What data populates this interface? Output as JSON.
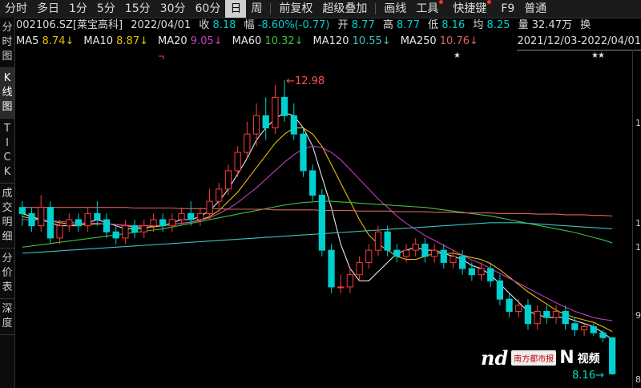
{
  "toolbar": {
    "items": [
      "分时",
      "多日",
      "1分",
      "5分",
      "15分",
      "30分",
      "60分",
      "日",
      "周",
      "前复权",
      "超级叠加",
      "画线",
      "工具",
      "快捷键",
      "F9",
      "普通"
    ],
    "active_index": 7
  },
  "sidebar": {
    "tabs": [
      {
        "label": "分时图",
        "chars": [
          "分",
          "时",
          "图"
        ]
      },
      {
        "label": "K线图",
        "chars": [
          "K",
          "线",
          "图"
        ]
      },
      {
        "label": "TICK",
        "chars": [
          "T",
          "I",
          "C",
          "K"
        ]
      },
      {
        "label": "成交明细",
        "chars": [
          "成",
          "交",
          "明",
          "细"
        ]
      },
      {
        "label": "分价表",
        "chars": [
          "分",
          "价",
          "表"
        ]
      },
      {
        "label": "深度",
        "chars": [
          "深",
          "度"
        ]
      }
    ],
    "active_index": 1
  },
  "info": {
    "symbol": "002106.SZ[莱宝高科]",
    "date": "2022/04/01",
    "close_label": "收",
    "close": "8.18",
    "change_label": "幅",
    "change": "-8.60%(-0.77)",
    "open_label": "开",
    "open": "8.77",
    "high_label": "高",
    "high": "8.77",
    "low_label": "低",
    "low": "8.16",
    "avg_label": "均",
    "avg": "8.25",
    "volume_label": "量",
    "volume": "32.47万",
    "amount_label": "换"
  },
  "ma": [
    {
      "label": "MA5",
      "value": "8.74↓",
      "color": "#e8e8e8",
      "value_color": "#e8c000"
    },
    {
      "label": "MA10",
      "value": "8.87↓",
      "color": "#e8e8e8",
      "value_color": "#e8c000"
    },
    {
      "label": "MA20",
      "value": "9.05↓",
      "color": "#e8e8e8",
      "value_color": "#c040c0"
    },
    {
      "label": "MA60",
      "value": "10.32↓",
      "color": "#e8e8e8",
      "value_color": "#40c040"
    },
    {
      "label": "MA120",
      "value": "10.55↓",
      "color": "#e8e8e8",
      "value_color": "#40c0c0"
    },
    {
      "label": "MA250",
      "value": "10.76↓",
      "color": "#e8e8e8",
      "value_color": "#e06060"
    }
  ],
  "range": "2021/12/03-2022/04/01",
  "axis_ticks": [
    "1",
    "1",
    "1",
    "9",
    "8"
  ],
  "annotations": {
    "high_label": "12.98",
    "low_label": "8.16"
  },
  "watermark": {
    "nd": "nd",
    "box": "南方都市报",
    "n": "N",
    "video": "视频"
  },
  "colors": {
    "up": "#ff3b3b",
    "down": "#00d0d0",
    "ma5": "#e8e8e8",
    "ma10": "#e8c000",
    "ma20": "#c040c0",
    "ma60": "#40c040",
    "ma120": "#40c0c0",
    "ma250": "#e06060"
  },
  "chart_data": {
    "type": "candlestick",
    "ylim": [
      8.0,
      13.4
    ],
    "high_marker": 12.98,
    "low_marker": 8.16,
    "candles": [
      [
        10.9,
        11.0,
        10.6,
        10.8
      ],
      [
        10.8,
        10.9,
        10.5,
        10.6
      ],
      [
        10.6,
        11.1,
        10.5,
        10.9
      ],
      [
        10.9,
        11.0,
        10.3,
        10.4
      ],
      [
        10.4,
        10.7,
        10.3,
        10.6
      ],
      [
        10.6,
        10.8,
        10.5,
        10.7
      ],
      [
        10.7,
        10.8,
        10.5,
        10.6
      ],
      [
        10.6,
        10.9,
        10.5,
        10.8
      ],
      [
        10.8,
        11.0,
        10.6,
        10.7
      ],
      [
        10.7,
        10.8,
        10.4,
        10.5
      ],
      [
        10.5,
        10.6,
        10.3,
        10.4
      ],
      [
        10.4,
        10.7,
        10.3,
        10.6
      ],
      [
        10.6,
        10.7,
        10.4,
        10.5
      ],
      [
        10.5,
        10.7,
        10.4,
        10.6
      ],
      [
        10.6,
        10.8,
        10.5,
        10.7
      ],
      [
        10.7,
        10.8,
        10.5,
        10.6
      ],
      [
        10.6,
        10.8,
        10.5,
        10.7
      ],
      [
        10.7,
        10.9,
        10.6,
        10.8
      ],
      [
        10.8,
        11.0,
        10.6,
        10.7
      ],
      [
        10.7,
        10.9,
        10.6,
        10.8
      ],
      [
        10.8,
        11.2,
        10.7,
        11.0
      ],
      [
        11.0,
        11.3,
        10.9,
        11.2
      ],
      [
        11.2,
        11.6,
        11.1,
        11.5
      ],
      [
        11.5,
        11.9,
        11.4,
        11.8
      ],
      [
        11.8,
        12.3,
        11.7,
        12.1
      ],
      [
        12.1,
        12.6,
        11.9,
        12.4
      ],
      [
        12.4,
        12.7,
        12.0,
        12.2
      ],
      [
        12.2,
        12.9,
        12.1,
        12.7
      ],
      [
        12.7,
        12.98,
        12.3,
        12.4
      ],
      [
        12.4,
        12.6,
        12.0,
        12.1
      ],
      [
        12.1,
        12.2,
        11.4,
        11.5
      ],
      [
        11.5,
        11.6,
        11.0,
        11.1
      ],
      [
        11.1,
        11.2,
        10.1,
        10.2
      ],
      [
        10.2,
        10.3,
        9.5,
        9.6
      ],
      [
        9.6,
        9.8,
        9.5,
        9.6
      ],
      [
        9.6,
        9.9,
        9.5,
        9.8
      ],
      [
        9.8,
        10.1,
        9.7,
        10.0
      ],
      [
        10.0,
        10.3,
        9.9,
        10.2
      ],
      [
        10.2,
        10.6,
        10.1,
        10.5
      ],
      [
        10.5,
        10.6,
        10.1,
        10.2
      ],
      [
        10.2,
        10.3,
        10.0,
        10.1
      ],
      [
        10.1,
        10.3,
        10.0,
        10.2
      ],
      [
        10.2,
        10.4,
        10.1,
        10.3
      ],
      [
        10.3,
        10.4,
        10.0,
        10.1
      ],
      [
        10.1,
        10.3,
        10.0,
        10.2
      ],
      [
        10.2,
        10.3,
        9.9,
        10.0
      ],
      [
        10.0,
        10.2,
        9.9,
        10.1
      ],
      [
        10.1,
        10.2,
        9.8,
        9.9
      ],
      [
        9.9,
        10.0,
        9.7,
        9.8
      ],
      [
        9.8,
        10.0,
        9.7,
        9.9
      ],
      [
        9.9,
        10.0,
        9.6,
        9.7
      ],
      [
        9.7,
        9.8,
        9.3,
        9.4
      ],
      [
        9.4,
        9.5,
        9.1,
        9.2
      ],
      [
        9.2,
        9.4,
        9.1,
        9.3
      ],
      [
        9.3,
        9.4,
        8.9,
        9.0
      ],
      [
        9.0,
        9.3,
        8.9,
        9.2
      ],
      [
        9.2,
        9.3,
        9.0,
        9.1
      ],
      [
        9.1,
        9.3,
        9.0,
        9.2
      ],
      [
        9.2,
        9.3,
        8.9,
        9.0
      ],
      [
        9.0,
        9.1,
        8.8,
        8.9
      ],
      [
        8.9,
        9.0,
        8.8,
        8.95
      ],
      [
        8.95,
        9.0,
        8.8,
        8.85
      ],
      [
        8.85,
        8.9,
        8.7,
        8.77
      ],
      [
        8.77,
        8.77,
        8.16,
        8.18
      ]
    ],
    "ma_series": [
      {
        "name": "MA5",
        "values": [
          10.8,
          10.75,
          10.7,
          10.65,
          10.6,
          10.6,
          10.6,
          10.65,
          10.7,
          10.65,
          10.6,
          10.55,
          10.55,
          10.55,
          10.6,
          10.6,
          10.65,
          10.7,
          10.7,
          10.75,
          10.85,
          11.0,
          11.2,
          11.45,
          11.7,
          12.0,
          12.2,
          12.35,
          12.45,
          12.4,
          12.2,
          11.9,
          11.4,
          10.9,
          10.3,
          9.9,
          9.7,
          9.7,
          9.85,
          10.0,
          10.15,
          10.2,
          10.25,
          10.2,
          10.2,
          10.15,
          10.1,
          10.05,
          9.95,
          9.9,
          9.8,
          9.65,
          9.5,
          9.35,
          9.2,
          9.15,
          9.1,
          9.1,
          9.1,
          9.05,
          9.0,
          8.95,
          8.85,
          8.74
        ]
      },
      {
        "name": "MA10",
        "values": [
          10.75,
          10.72,
          10.7,
          10.68,
          10.65,
          10.63,
          10.62,
          10.62,
          10.63,
          10.63,
          10.62,
          10.6,
          10.58,
          10.58,
          10.58,
          10.6,
          10.62,
          10.64,
          10.66,
          10.7,
          10.75,
          10.85,
          11.0,
          11.15,
          11.35,
          11.55,
          11.75,
          11.95,
          12.1,
          12.2,
          12.2,
          12.1,
          11.9,
          11.6,
          11.3,
          11.0,
          10.7,
          10.45,
          10.3,
          10.2,
          10.1,
          10.05,
          10.05,
          10.1,
          10.15,
          10.15,
          10.15,
          10.12,
          10.08,
          10.05,
          9.98,
          9.88,
          9.76,
          9.64,
          9.52,
          9.42,
          9.32,
          9.22,
          9.15,
          9.1,
          9.06,
          9.02,
          8.95,
          8.87
        ]
      },
      {
        "name": "MA20",
        "values": [
          10.7,
          10.7,
          10.69,
          10.68,
          10.67,
          10.66,
          10.65,
          10.64,
          10.64,
          10.63,
          10.62,
          10.61,
          10.6,
          10.6,
          10.6,
          10.61,
          10.62,
          10.64,
          10.66,
          10.69,
          10.73,
          10.8,
          10.88,
          10.98,
          11.1,
          11.22,
          11.36,
          11.5,
          11.64,
          11.76,
          11.86,
          11.9,
          11.88,
          11.8,
          11.68,
          11.52,
          11.36,
          11.2,
          11.04,
          10.9,
          10.76,
          10.64,
          10.54,
          10.44,
          10.36,
          10.28,
          10.2,
          10.12,
          10.04,
          9.98,
          9.9,
          9.82,
          9.74,
          9.66,
          9.58,
          9.5,
          9.42,
          9.34,
          9.27,
          9.2,
          9.15,
          9.1,
          9.07,
          9.05
        ]
      },
      {
        "name": "MA60",
        "values": [
          10.25,
          10.27,
          10.29,
          10.31,
          10.33,
          10.35,
          10.37,
          10.39,
          10.41,
          10.43,
          10.45,
          10.47,
          10.49,
          10.51,
          10.53,
          10.55,
          10.58,
          10.61,
          10.64,
          10.67,
          10.7,
          10.73,
          10.76,
          10.79,
          10.82,
          10.85,
          10.88,
          10.91,
          10.94,
          10.96,
          10.98,
          10.99,
          11.0,
          11.0,
          10.99,
          10.98,
          10.97,
          10.96,
          10.95,
          10.94,
          10.93,
          10.92,
          10.91,
          10.9,
          10.88,
          10.86,
          10.84,
          10.82,
          10.8,
          10.78,
          10.76,
          10.73,
          10.7,
          10.67,
          10.64,
          10.61,
          10.58,
          10.55,
          10.52,
          10.49,
          10.45,
          10.41,
          10.37,
          10.32
        ]
      },
      {
        "name": "MA120",
        "values": [
          10.15,
          10.16,
          10.17,
          10.18,
          10.19,
          10.2,
          10.21,
          10.22,
          10.23,
          10.24,
          10.25,
          10.26,
          10.27,
          10.28,
          10.29,
          10.3,
          10.31,
          10.32,
          10.33,
          10.34,
          10.35,
          10.36,
          10.37,
          10.38,
          10.39,
          10.4,
          10.41,
          10.42,
          10.43,
          10.44,
          10.45,
          10.46,
          10.47,
          10.48,
          10.49,
          10.5,
          10.51,
          10.52,
          10.53,
          10.54,
          10.55,
          10.56,
          10.57,
          10.58,
          10.59,
          10.6,
          10.61,
          10.62,
          10.63,
          10.64,
          10.65,
          10.65,
          10.65,
          10.65,
          10.64,
          10.63,
          10.62,
          10.61,
          10.6,
          10.59,
          10.58,
          10.57,
          10.56,
          10.55
        ]
      },
      {
        "name": "MA250",
        "values": [
          10.9,
          10.9,
          10.9,
          10.9,
          10.9,
          10.9,
          10.9,
          10.9,
          10.9,
          10.9,
          10.9,
          10.9,
          10.89,
          10.89,
          10.89,
          10.89,
          10.89,
          10.88,
          10.88,
          10.88,
          10.88,
          10.88,
          10.87,
          10.87,
          10.87,
          10.87,
          10.87,
          10.86,
          10.86,
          10.86,
          10.86,
          10.86,
          10.85,
          10.85,
          10.85,
          10.85,
          10.84,
          10.84,
          10.84,
          10.84,
          10.83,
          10.83,
          10.83,
          10.83,
          10.82,
          10.82,
          10.82,
          10.81,
          10.81,
          10.81,
          10.81,
          10.8,
          10.8,
          10.8,
          10.8,
          10.79,
          10.79,
          10.79,
          10.78,
          10.78,
          10.78,
          10.77,
          10.77,
          10.76
        ]
      }
    ]
  }
}
